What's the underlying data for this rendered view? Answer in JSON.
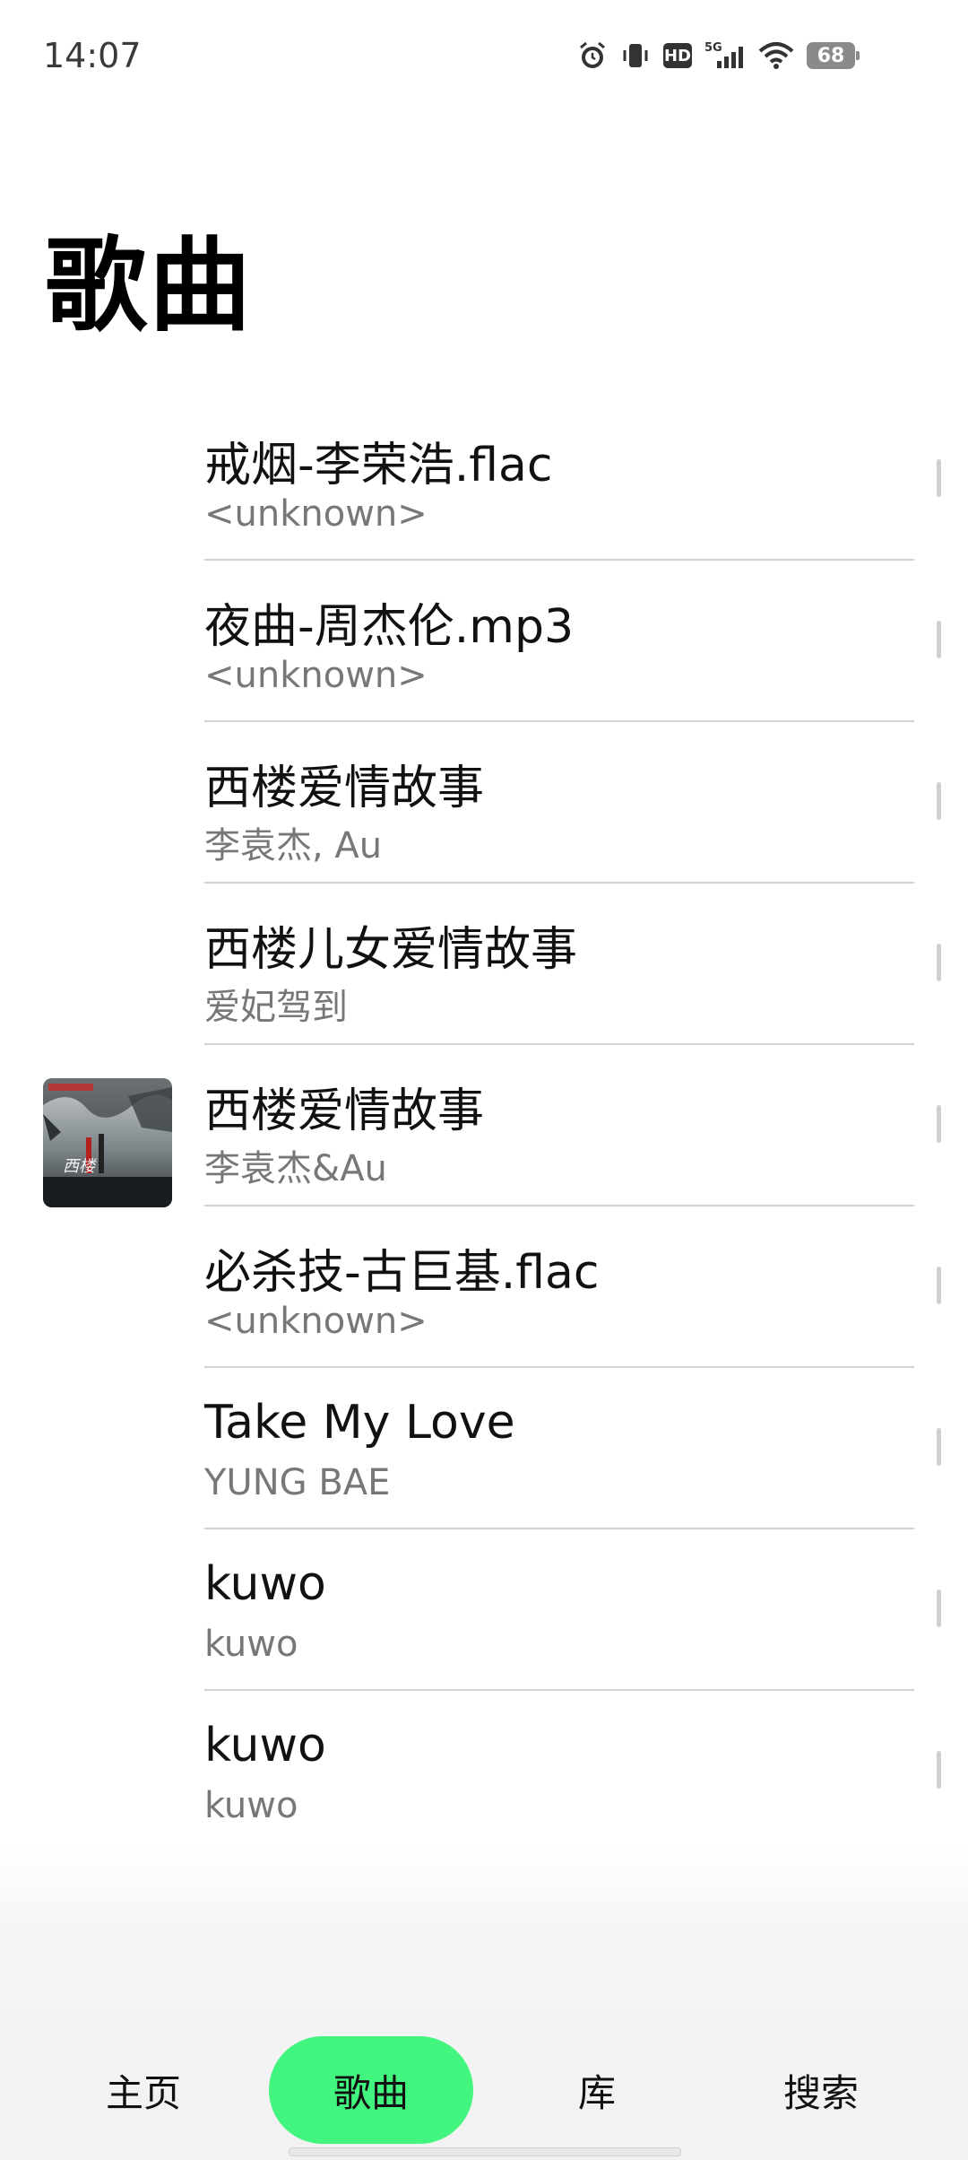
{
  "status_bar": {
    "time": "14:07",
    "network": "5G",
    "hd_label": "HD",
    "battery": "68"
  },
  "page": {
    "title": "歌曲"
  },
  "songs": [
    {
      "title": "戒烟-李荣浩.flac",
      "artist": "<unknown>",
      "has_cover": false
    },
    {
      "title": "夜曲-周杰伦.mp3",
      "artist": "<unknown>",
      "has_cover": false
    },
    {
      "title": "西楼爱情故事",
      "artist": "李袁杰, Au",
      "has_cover": false
    },
    {
      "title": "西楼儿女爱情故事",
      "artist": "爱妃驾到",
      "has_cover": false
    },
    {
      "title": "西楼爱情故事",
      "artist": "李袁杰&Au",
      "has_cover": true
    },
    {
      "title": "必杀技-古巨基.flac",
      "artist": "<unknown>",
      "has_cover": false
    },
    {
      "title": "Take My Love",
      "artist": "YUNG BAE",
      "has_cover": false
    },
    {
      "title": "kuwo",
      "artist": "kuwo",
      "has_cover": false
    },
    {
      "title": "kuwo",
      "artist": "kuwo",
      "has_cover": false
    }
  ],
  "nav": {
    "home": "主页",
    "songs": "歌曲",
    "library": "库",
    "search": "搜索",
    "active": "songs",
    "active_color": "#41f57e"
  }
}
